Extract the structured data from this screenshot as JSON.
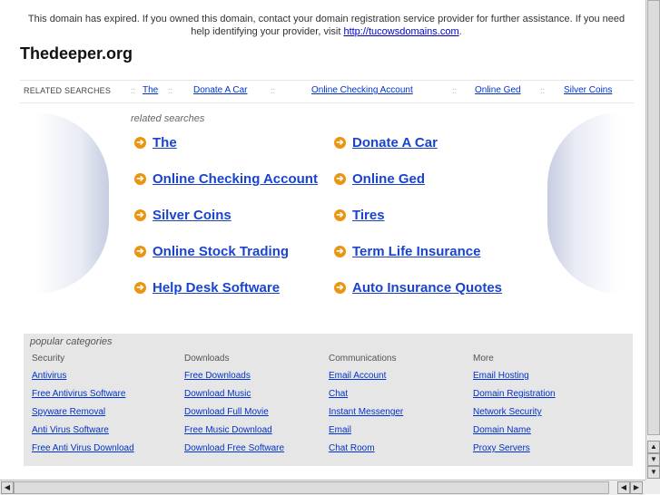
{
  "notice": {
    "text": "This domain has expired. If you owned this domain, contact your domain registration service provider for further assistance. If you need help identifying your provider, visit ",
    "link": "http://tucowsdomains.com",
    "end": "."
  },
  "domain": "Thedeeper.org",
  "related_bar": {
    "heading": "RELATED SEARCHES",
    "separator": "::",
    "links": [
      "The",
      "Donate A Car",
      "Online Checking Account",
      "Online Ged",
      "Silver Coins"
    ]
  },
  "related": {
    "label": "related searches",
    "arrow_glyph": "➔",
    "items": [
      "The",
      "Donate A Car",
      "Online Checking Account",
      "Online Ged",
      "Silver Coins",
      "Tires",
      "Online Stock Trading",
      "Term Life Insurance",
      "Help Desk Software",
      "Auto Insurance Quotes"
    ]
  },
  "popular": {
    "title": "popular categories",
    "columns": [
      {
        "heading": "Security",
        "links": [
          "Antivirus",
          "Free Antivirus Software",
          "Spyware Removal",
          "Anti Virus Software",
          "Free Anti Virus Download"
        ]
      },
      {
        "heading": "Downloads",
        "links": [
          "Free Downloads",
          "Download Music",
          "Download Full Movie",
          "Free Music Download",
          "Download Free Software"
        ]
      },
      {
        "heading": "Communications",
        "links": [
          "Email Account",
          "Chat",
          "Instant Messenger",
          "Email",
          "Chat Room"
        ]
      },
      {
        "heading": "More",
        "links": [
          "Email Hosting",
          "Domain Registration",
          "Network Security",
          "Domain Name",
          "Proxy Servers"
        ]
      }
    ]
  },
  "scrollbars": {
    "up": "▲",
    "down": "▼",
    "down2": "▼",
    "left": "◀",
    "right": "▶",
    "left2": "◀"
  },
  "colors": {
    "link": "#1a44cc",
    "arrow": "#e8950f",
    "popular_bg": "#e6e6e6"
  }
}
